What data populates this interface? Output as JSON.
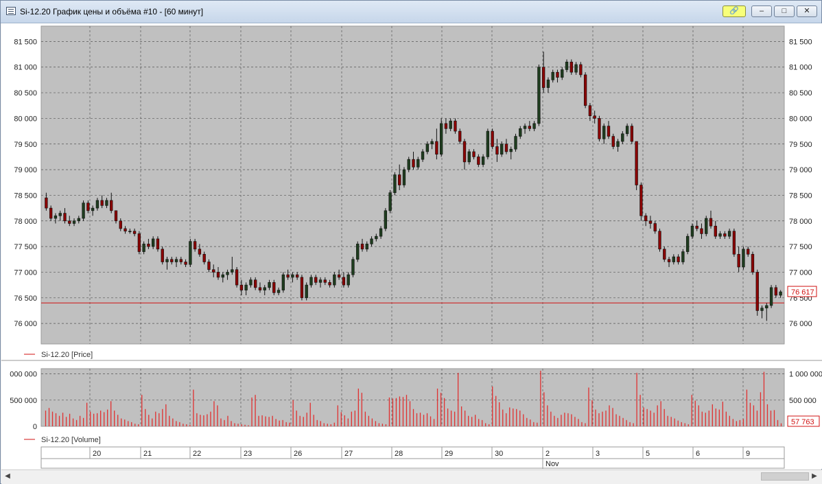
{
  "window": {
    "title": "Si-12.20 График цены и объёма #10 - [60 минут]",
    "buttons": {
      "link": "🔗",
      "minimize": "–",
      "maximize": "□",
      "close": "✕"
    }
  },
  "colors": {
    "up": "#1f3d1f",
    "down": "#8b0000",
    "volume": "#e03030",
    "level_line": "#d01010",
    "panel_bg": "#c0c0c0"
  },
  "chart_data": [
    {
      "type": "candlestick",
      "legend": "Si-12.20 [Price]",
      "ylim": [
        75600,
        81800
      ],
      "yticks": [
        76000,
        76500,
        77000,
        77500,
        78000,
        78500,
        79000,
        79500,
        80000,
        80500,
        81000,
        81500
      ],
      "ytick_labels": [
        "76 000",
        "76 500",
        "77 000",
        "77 500",
        "78 000",
        "78 500",
        "79 000",
        "79 500",
        "80 000",
        "80 500",
        "81 000",
        "81 500"
      ],
      "grid": true,
      "last_value_label": "76 617",
      "horizontal_level": 76400,
      "ohlc": [
        [
          78450,
          78550,
          78200,
          78250
        ],
        [
          78250,
          78300,
          78000,
          78050
        ],
        [
          78050,
          78150,
          77950,
          78100
        ],
        [
          78100,
          78200,
          78000,
          78150
        ],
        [
          78150,
          78250,
          77950,
          78000
        ],
        [
          78000,
          78100,
          77900,
          77950
        ],
        [
          77950,
          78050,
          77900,
          78000
        ],
        [
          78000,
          78100,
          77950,
          78050
        ],
        [
          78050,
          78400,
          78000,
          78350
        ],
        [
          78350,
          78400,
          78150,
          78200
        ],
        [
          78200,
          78300,
          78100,
          78250
        ],
        [
          78250,
          78450,
          78200,
          78400
        ],
        [
          78400,
          78500,
          78250,
          78300
        ],
        [
          78300,
          78450,
          78250,
          78400
        ],
        [
          78400,
          78550,
          78150,
          78200
        ],
        [
          78200,
          78200,
          77950,
          78000
        ],
        [
          78000,
          78050,
          77800,
          77850
        ],
        [
          77850,
          77900,
          77750,
          77800
        ],
        [
          77800,
          77850,
          77750,
          77800
        ],
        [
          77800,
          77850,
          77700,
          77750
        ],
        [
          77750,
          77800,
          77350,
          77400
        ],
        [
          77400,
          77600,
          77350,
          77550
        ],
        [
          77550,
          77650,
          77450,
          77500
        ],
        [
          77500,
          77700,
          77450,
          77650
        ],
        [
          77650,
          77700,
          77400,
          77450
        ],
        [
          77450,
          77500,
          77150,
          77200
        ],
        [
          77200,
          77300,
          77050,
          77250
        ],
        [
          77250,
          77300,
          77150,
          77200
        ],
        [
          77200,
          77300,
          77100,
          77250
        ],
        [
          77250,
          77300,
          77150,
          77200
        ],
        [
          77200,
          77250,
          77100,
          77150
        ],
        [
          77150,
          77650,
          77100,
          77600
        ],
        [
          77600,
          77650,
          77400,
          77450
        ],
        [
          77450,
          77550,
          77300,
          77350
        ],
        [
          77350,
          77400,
          77150,
          77200
        ],
        [
          77200,
          77250,
          77000,
          77050
        ],
        [
          77050,
          77150,
          76900,
          77000
        ],
        [
          77000,
          77100,
          76850,
          76900
        ],
        [
          76900,
          77000,
          76800,
          76950
        ],
        [
          76950,
          77050,
          76850,
          77000
        ],
        [
          77000,
          77300,
          76950,
          77050
        ],
        [
          77050,
          77100,
          76700,
          76750
        ],
        [
          76750,
          76850,
          76550,
          76650
        ],
        [
          76650,
          76800,
          76550,
          76750
        ],
        [
          76750,
          76900,
          76700,
          76850
        ],
        [
          76850,
          76900,
          76650,
          76700
        ],
        [
          76700,
          76800,
          76600,
          76650
        ],
        [
          76650,
          76750,
          76550,
          76700
        ],
        [
          76700,
          76850,
          76650,
          76800
        ],
        [
          76800,
          76850,
          76550,
          76600
        ],
        [
          76600,
          76700,
          76550,
          76650
        ],
        [
          76650,
          77000,
          76600,
          76950
        ],
        [
          76950,
          77050,
          76850,
          76900
        ],
        [
          76900,
          77000,
          76800,
          76950
        ],
        [
          76950,
          77000,
          76850,
          76900
        ],
        [
          76900,
          76950,
          76450,
          76500
        ],
        [
          76500,
          76800,
          76450,
          76750
        ],
        [
          76750,
          76950,
          76700,
          76900
        ],
        [
          76900,
          76950,
          76750,
          76800
        ],
        [
          76800,
          76900,
          76700,
          76850
        ],
        [
          76850,
          76900,
          76750,
          76800
        ],
        [
          76800,
          76850,
          76700,
          76750
        ],
        [
          76750,
          77000,
          76700,
          76950
        ],
        [
          76950,
          77050,
          76850,
          76900
        ],
        [
          76900,
          77000,
          76700,
          76750
        ],
        [
          76750,
          77000,
          76700,
          76950
        ],
        [
          76950,
          77300,
          76900,
          77250
        ],
        [
          77250,
          77600,
          77200,
          77550
        ],
        [
          77550,
          77650,
          77400,
          77450
        ],
        [
          77450,
          77600,
          77400,
          77550
        ],
        [
          77550,
          77700,
          77500,
          77650
        ],
        [
          77650,
          77750,
          77600,
          77700
        ],
        [
          77700,
          77900,
          77650,
          77850
        ],
        [
          77850,
          78250,
          77800,
          78200
        ],
        [
          78200,
          78600,
          78150,
          78550
        ],
        [
          78550,
          78950,
          78500,
          78900
        ],
        [
          78900,
          79100,
          78600,
          78700
        ],
        [
          78700,
          79050,
          78650,
          79000
        ],
        [
          79000,
          79250,
          78950,
          79200
        ],
        [
          79200,
          79350,
          79000,
          79050
        ],
        [
          79050,
          79250,
          79000,
          79200
        ],
        [
          79200,
          79400,
          79150,
          79350
        ],
        [
          79350,
          79550,
          79300,
          79500
        ],
        [
          79500,
          79600,
          79400,
          79550
        ],
        [
          79550,
          79800,
          79200,
          79300
        ],
        [
          79300,
          80000,
          79250,
          79900
        ],
        [
          79900,
          80000,
          79700,
          79800
        ],
        [
          79800,
          80000,
          79750,
          79950
        ],
        [
          79950,
          80000,
          79700,
          79750
        ],
        [
          79750,
          79800,
          79500,
          79550
        ],
        [
          79550,
          79600,
          79000,
          79150
        ],
        [
          79150,
          79400,
          79100,
          79350
        ],
        [
          79350,
          79400,
          79200,
          79250
        ],
        [
          79250,
          79300,
          79050,
          79100
        ],
        [
          79100,
          79300,
          79050,
          79250
        ],
        [
          79250,
          79800,
          79200,
          79750
        ],
        [
          79750,
          79800,
          79400,
          79450
        ],
        [
          79450,
          79600,
          79150,
          79300
        ],
        [
          79300,
          79550,
          79250,
          79500
        ],
        [
          79500,
          79600,
          79300,
          79350
        ],
        [
          79350,
          79450,
          79200,
          79400
        ],
        [
          79400,
          79700,
          79350,
          79650
        ],
        [
          79650,
          79850,
          79600,
          79800
        ],
        [
          79800,
          79900,
          79700,
          79850
        ],
        [
          79850,
          79950,
          79750,
          79800
        ],
        [
          79800,
          79950,
          79750,
          79900
        ],
        [
          79900,
          81050,
          79850,
          81000
        ],
        [
          81000,
          81300,
          80500,
          80600
        ],
        [
          80600,
          80800,
          80500,
          80750
        ],
        [
          80750,
          80950,
          80700,
          80900
        ],
        [
          80900,
          80950,
          80700,
          80800
        ],
        [
          80800,
          81000,
          80750,
          80950
        ],
        [
          80950,
          81150,
          80900,
          81100
        ],
        [
          81100,
          81150,
          80850,
          80900
        ],
        [
          80900,
          81100,
          80850,
          81050
        ],
        [
          81050,
          81100,
          80800,
          80850
        ],
        [
          80850,
          80900,
          80200,
          80250
        ],
        [
          80250,
          80300,
          79950,
          80050
        ],
        [
          80050,
          80150,
          79900,
          80000
        ],
        [
          80000,
          80050,
          79550,
          79600
        ],
        [
          79600,
          79900,
          79500,
          79850
        ],
        [
          79850,
          79950,
          79600,
          79650
        ],
        [
          79650,
          79700,
          79400,
          79450
        ],
        [
          79450,
          79600,
          79350,
          79550
        ],
        [
          79550,
          79750,
          79500,
          79700
        ],
        [
          79700,
          79900,
          79650,
          79850
        ],
        [
          79850,
          79900,
          79500,
          79550
        ],
        [
          79550,
          79550,
          78600,
          78700
        ],
        [
          78700,
          78750,
          78000,
          78100
        ],
        [
          78100,
          78150,
          77900,
          78000
        ],
        [
          78000,
          78100,
          77850,
          77950
        ],
        [
          77950,
          78000,
          77750,
          77800
        ],
        [
          77800,
          77850,
          77400,
          77450
        ],
        [
          77450,
          77500,
          77200,
          77250
        ],
        [
          77250,
          77300,
          77100,
          77200
        ],
        [
          77200,
          77350,
          77150,
          77300
        ],
        [
          77300,
          77350,
          77150,
          77200
        ],
        [
          77200,
          77450,
          77150,
          77400
        ],
        [
          77400,
          77750,
          77350,
          77700
        ],
        [
          77700,
          77950,
          77650,
          77900
        ],
        [
          77900,
          78000,
          77800,
          77850
        ],
        [
          77850,
          77950,
          77650,
          77750
        ],
        [
          77750,
          78100,
          77700,
          78050
        ],
        [
          78050,
          78200,
          77850,
          77900
        ],
        [
          77900,
          78000,
          77650,
          77700
        ],
        [
          77700,
          77800,
          77650,
          77750
        ],
        [
          77750,
          77800,
          77650,
          77700
        ],
        [
          77700,
          77850,
          77650,
          77800
        ],
        [
          77800,
          77850,
          77300,
          77350
        ],
        [
          77350,
          77500,
          77000,
          77100
        ],
        [
          77100,
          77500,
          77050,
          77450
        ],
        [
          77450,
          77500,
          77300,
          77350
        ],
        [
          77350,
          77400,
          76950,
          77000
        ],
        [
          77000,
          77050,
          76150,
          76250
        ],
        [
          76250,
          76350,
          76100,
          76300
        ],
        [
          76300,
          76400,
          76050,
          76350
        ],
        [
          76350,
          76750,
          76300,
          76700
        ],
        [
          76700,
          76750,
          76500,
          76550
        ],
        [
          76550,
          76650,
          76500,
          76617
        ]
      ]
    },
    {
      "type": "bar",
      "legend": "Si-12.20 [Volume]",
      "ylim": [
        0,
        1100000
      ],
      "yticks": [
        0,
        500000,
        1000000
      ],
      "ytick_labels_left": [
        "0",
        "500 000",
        "000 000"
      ],
      "ytick_labels_right": [
        "",
        "500 000",
        "1 000 000"
      ],
      "last_value_label": "57 763",
      "values": [
        300000,
        350000,
        280000,
        250000,
        200000,
        260000,
        180000,
        240000,
        150000,
        120000,
        200000,
        160000,
        450000,
        280000,
        240000,
        250000,
        300000,
        270000,
        320000,
        480000,
        300000,
        220000,
        150000,
        130000,
        100000,
        80000,
        50000,
        40000,
        600000,
        330000,
        220000,
        150000,
        280000,
        250000,
        330000,
        420000,
        200000,
        150000,
        100000,
        80000,
        50000,
        40000,
        30000,
        700000,
        250000,
        220000,
        210000,
        230000,
        280000,
        480000,
        400000,
        150000,
        120000,
        200000,
        100000,
        60000,
        50000,
        40000,
        30000,
        20000,
        550000,
        600000,
        200000,
        210000,
        190000,
        180000,
        200000,
        140000,
        110000,
        120000,
        80000,
        70000,
        500000,
        300000,
        200000,
        180000,
        260000,
        450000,
        220000,
        120000,
        100000,
        60000,
        50000,
        40000,
        70000,
        400000,
        270000,
        210000,
        150000,
        280000,
        300000,
        720000,
        640000,
        280000,
        200000,
        150000,
        100000,
        60000,
        50000,
        40000,
        550000,
        530000,
        540000,
        570000,
        560000,
        600000,
        480000,
        330000,
        250000,
        260000,
        220000,
        250000,
        190000,
        140000,
        720000,
        640000,
        540000,
        340000,
        300000,
        280000,
        1020000,
        380000,
        300000,
        200000,
        180000,
        220000,
        140000,
        120000,
        60000,
        40000,
        760000,
        580000,
        460000,
        320000,
        250000,
        360000,
        340000,
        330000,
        300000,
        230000,
        160000,
        130000,
        80000,
        70000,
        1060000,
        650000,
        400000,
        280000,
        200000,
        160000,
        220000,
        260000,
        250000,
        230000,
        180000,
        140000,
        80000,
        60000,
        740000,
        500000,
        320000,
        250000,
        280000,
        300000,
        400000,
        350000,
        230000,
        200000,
        160000,
        120000,
        80000,
        60000,
        1020000,
        600000,
        360000,
        330000,
        300000,
        260000,
        400000,
        480000,
        330000,
        200000,
        180000,
        150000,
        110000,
        80000,
        60000,
        40000,
        600000,
        490000,
        400000,
        280000,
        260000,
        300000,
        420000,
        340000,
        320000,
        470000,
        280000,
        200000,
        140000,
        100000,
        120000,
        140000,
        700000,
        450000,
        400000,
        300000,
        650000,
        1040000,
        420000,
        300000,
        310000,
        120000,
        57763
      ]
    }
  ],
  "time_axis": {
    "day_labels": [
      "20",
      "21",
      "22",
      "23",
      "26",
      "27",
      "28",
      "29",
      "30",
      "2",
      "3",
      "5",
      "6",
      "9"
    ],
    "month_labels": [
      "Nov"
    ]
  }
}
